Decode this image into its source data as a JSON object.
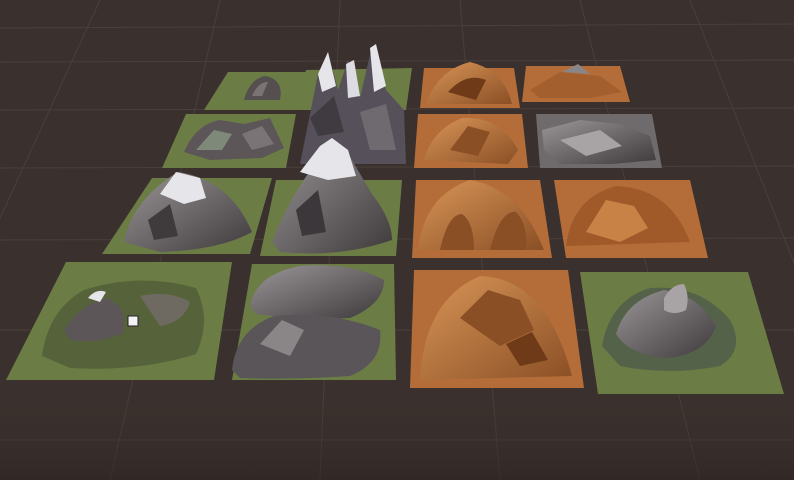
{
  "scene": {
    "background_color": "#3a302d",
    "grid_line_color": "#4a3f3b",
    "tile_colors": {
      "grass": "#6b7d44",
      "grass_light": "#7a8c4f",
      "sand": "#b46d38",
      "sand_light": "#c98245",
      "rock_dark": "#4a4648",
      "rock_mid": "#6f6a6c",
      "rock_light": "#9a9597",
      "snow": "#e6e6ea"
    },
    "tiles": [
      {
        "name": "rounded-rock-tile",
        "terrain": "grass",
        "feature": "rounded-rock"
      },
      {
        "name": "snowy-spires-tile",
        "terrain": "grass",
        "feature": "snowy-spires"
      },
      {
        "name": "sand-dome-tile",
        "terrain": "sand",
        "feature": "sand-dome"
      },
      {
        "name": "sand-flat-rock-tile",
        "terrain": "sand",
        "feature": "flat-rocky"
      },
      {
        "name": "cliffs-plateau-tile",
        "terrain": "grass",
        "feature": "cliffs"
      },
      {
        "name": "sand-rough-tile",
        "terrain": "sand",
        "feature": "rough-rock"
      },
      {
        "name": "grey-slabs-tile",
        "terrain": "rock",
        "feature": "slabs"
      },
      {
        "name": "snowcap-mountain-tile",
        "terrain": "grass",
        "feature": "snowcap-mountain"
      },
      {
        "name": "tall-snow-peak-tile",
        "terrain": "grass",
        "feature": "tall-peak"
      },
      {
        "name": "sand-arches-tile",
        "terrain": "sand",
        "feature": "arches"
      },
      {
        "name": "sand-rubble-tile",
        "terrain": "sand",
        "feature": "rubble"
      },
      {
        "name": "green-hills-tile",
        "terrain": "grass",
        "feature": "terraced-hills"
      },
      {
        "name": "rocky-ridges-tile",
        "terrain": "grass",
        "feature": "ridges"
      },
      {
        "name": "sand-craggy-tile",
        "terrain": "sand",
        "feature": "craggy"
      },
      {
        "name": "crater-mound-tile",
        "terrain": "grass",
        "feature": "crater-mound"
      }
    ]
  }
}
